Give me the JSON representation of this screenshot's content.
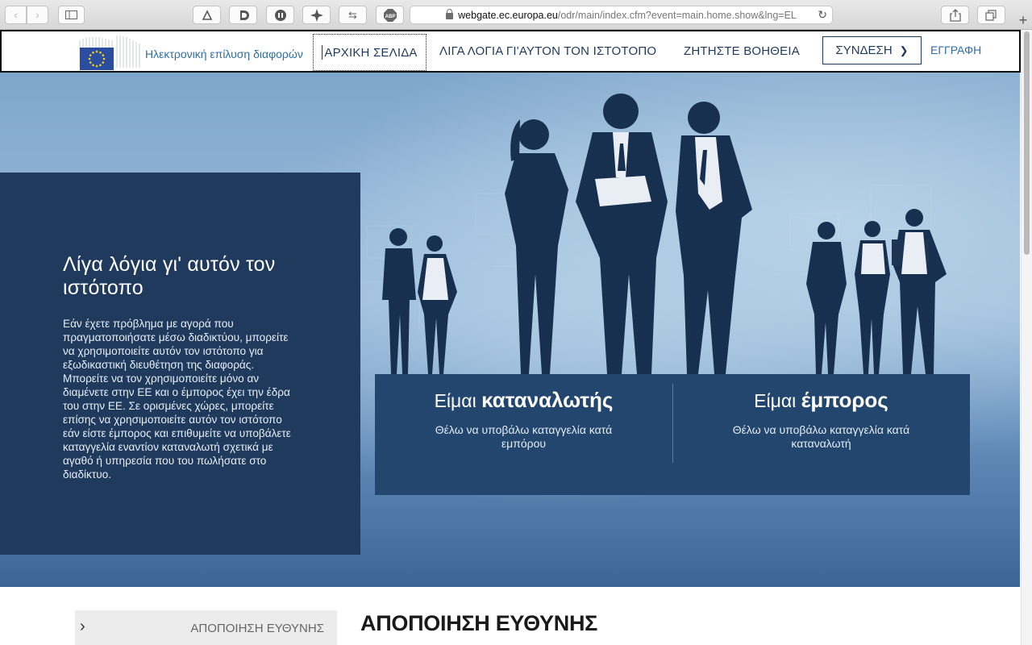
{
  "browser": {
    "url_host": "webgate.ec.europa.eu",
    "url_path": "/odr/main/index.cfm?event=main.home.show&lng=EL",
    "toolbar_icons": [
      "back-icon",
      "forward-icon",
      "sidebar-icon",
      "extension-icon",
      "disconnect-icon",
      "ghostery-icon",
      "puzzle-icon",
      "arrows-icon",
      "adblock-icon",
      "share-icon",
      "tabs-icon",
      "new-tab-icon",
      "reload-icon"
    ],
    "adblock_label": "ABP"
  },
  "header": {
    "site_name": "Ηλεκτρονική επίλυση διαφορών",
    "nav": {
      "home": "ΑΡΧΙΚΗ ΣΕΛΙΔΑ",
      "about": "ΛΙΓΑ ΛΟΓΙΑ ΓΙ'ΑΥΤΟΝ ΤΟΝ ΙΣΤΟΤΟΠΟ",
      "help": "ΖΗΤΗΣΤΕ ΒΟΗΘΕΙΑ"
    },
    "login": "ΣΥΝΔΕΣΗ",
    "register": "ΕΓΓΡΑΦΗ"
  },
  "hero": {
    "title": "Λίγα λόγια γι' αυτόν τον ιστότοπο",
    "text": "Εάν έχετε πρόβλημα με αγορά που πραγματοποιήσατε μέσω διαδικτύου, μπορείτε να χρησιμοποιείτε αυτόν τον ιστότοπο για εξωδικαστική διευθέτηση της διαφοράς. Μπορείτε να τον χρησιμοποιείτε μόνο αν διαμένετε στην ΕΕ και ο έμπορος έχει την έδρα του στην ΕΕ. Σε ορισμένες χώρες, μπορείτε επίσης να χρησιμοποιείτε αυτόν τον ιστότοπο εάν είστε έμπορος και επιθυμείτε να υποβάλετε καταγγελία εναντίον καταναλωτή σχετικά με αγαθό ή υπηρεσία που του πωλήσατε στο διαδίκτυο.",
    "consumer": {
      "prefix": "Είμαι",
      "title": "καταναλωτής",
      "subtitle": "Θέλω να υποβάλω καταγγελία κατά εμπόρου"
    },
    "trader": {
      "prefix": "Είμαι",
      "title": "έμπορος",
      "subtitle": "Θέλω να υποβάλω καταγγελία κατά καταναλωτή"
    }
  },
  "disclaimer": {
    "tab_label": "ΑΠΟΠΟΙΗΣΗ ΕΥΘΥΝΗΣ",
    "heading": "ΑΠΟΠΟΙΗΣΗ ΕΥΘΥΝΗΣ"
  },
  "colors": {
    "brand_dark": "#1f3a5c",
    "brand_link": "#2e6ea5",
    "choice_panel": "#23466e"
  }
}
